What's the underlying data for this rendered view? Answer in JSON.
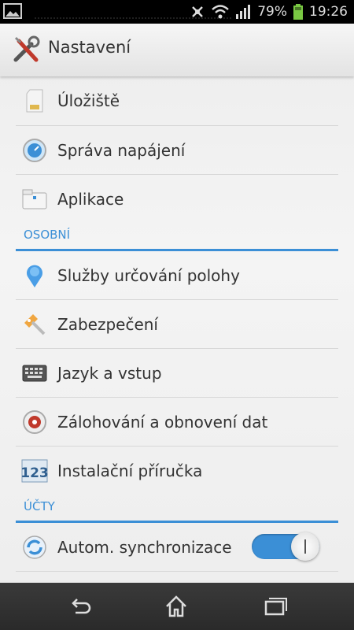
{
  "status": {
    "battery": "79%",
    "time": "19:26"
  },
  "header": {
    "title": "Nastavení"
  },
  "items_top": [
    {
      "label": "Úložiště",
      "icon": "sd-card-icon"
    },
    {
      "label": "Správa napájení",
      "icon": "power-gauge-icon"
    },
    {
      "label": "Aplikace",
      "icon": "folder-apps-icon"
    }
  ],
  "sections": {
    "personal": "OSOBNÍ",
    "accounts": "ÚČTY"
  },
  "items_personal": [
    {
      "label": "Služby určování polohy",
      "icon": "location-pin-icon"
    },
    {
      "label": "Zabezpečení",
      "icon": "security-key-icon"
    },
    {
      "label": "Jazyk a vstup",
      "icon": "keyboard-icon"
    },
    {
      "label": "Zálohování a obnovení dat",
      "icon": "backup-icon"
    },
    {
      "label": "Instalační příručka",
      "icon": "setup-guide-icon"
    }
  ],
  "items_accounts": [
    {
      "label": "Autom. synchronizace",
      "icon": "sync-icon",
      "toggle_on": true
    }
  ],
  "colors": {
    "accent": "#3b8fd6"
  }
}
